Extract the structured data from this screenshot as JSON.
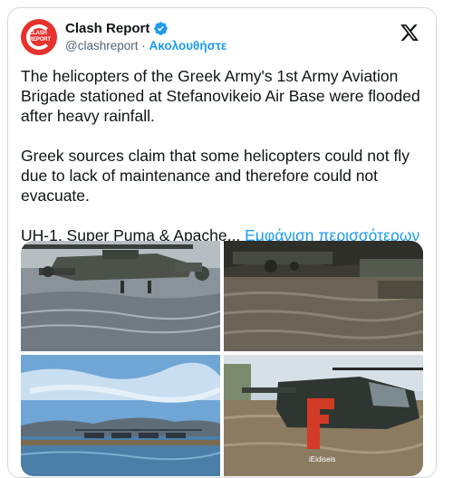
{
  "tweet": {
    "author_name": "Clash Report",
    "author_handle": "@clashreport",
    "separator": "·",
    "follow_label": "Ακολουθήστε",
    "avatar_text_line1": "CLASH",
    "avatar_text_line2": "REPORT",
    "paragraph1": "The helicopters of the Greek Army's 1st Army Aviation Brigade stationed at Stefanovikeio Air Base were flooded after heavy rainfall.",
    "paragraph2": "Greek sources claim that some helicopters could not fly due to lack of maintenance and therefore could not evacuate.",
    "paragraph3": "UH-1, Super Puma & Apache...",
    "show_more": "Εμφάνιση περισσότερων",
    "watermark": "iEidiseis"
  },
  "icons": {
    "verified": "verified-badge-icon",
    "platform": "x-logo-icon"
  },
  "colors": {
    "accent": "#1d9bf0",
    "avatar_red": "#e5322d",
    "text": "#0f1419",
    "muted": "#536471"
  }
}
